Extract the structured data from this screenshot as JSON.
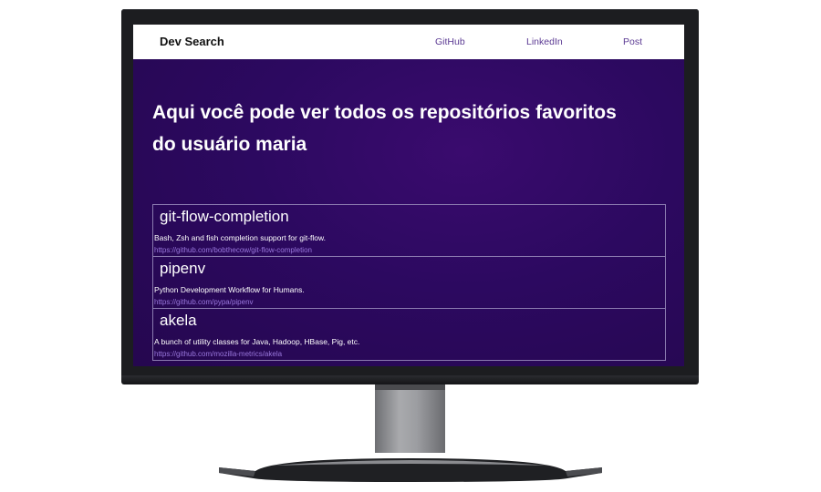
{
  "nav": {
    "brand": "Dev Search",
    "links": [
      "GitHub",
      "LinkedIn",
      "Post"
    ]
  },
  "hero": {
    "headline": "Aqui você pode ver todos os repositórios favoritos do usuário maria"
  },
  "repos": [
    {
      "name": "git-flow-completion",
      "description": "Bash, Zsh and fish completion support for git-flow.",
      "url": "https://github.com/bobthecow/git-flow-completion"
    },
    {
      "name": "pipenv",
      "description": "Python Development Workflow for Humans.",
      "url": "https://github.com/pypa/pipenv"
    },
    {
      "name": "akela",
      "description": "A bunch of utility classes for Java, Hadoop, HBase, Pig, etc.",
      "url": "https://github.com/mozilla-metrics/akela"
    }
  ],
  "colors": {
    "hero_bg": "#2b0a5c",
    "nav_link": "#5b3a93",
    "repo_link": "#9a78dd"
  }
}
